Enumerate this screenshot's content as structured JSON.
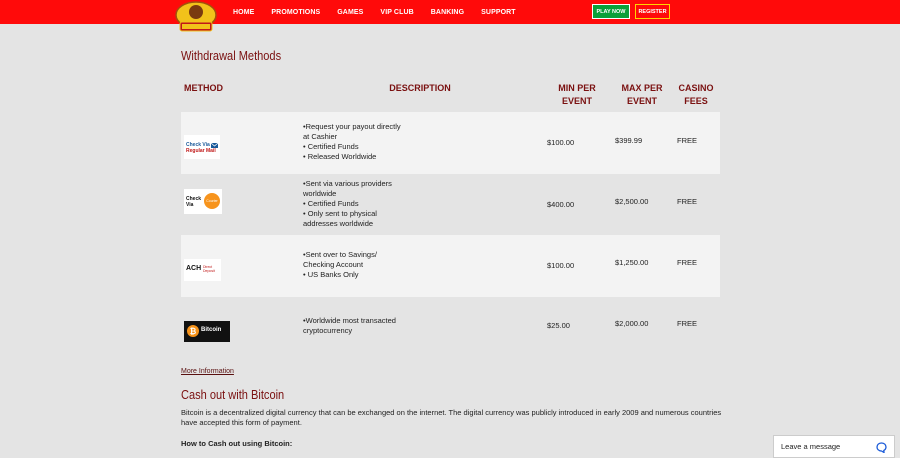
{
  "nav": {
    "items": [
      "HOME",
      "PROMOTIONS",
      "GAMES",
      "VIP CLUB",
      "BANKING",
      "SUPPORT"
    ],
    "play_label": "PLAY NOW",
    "register_label": "REGISTER"
  },
  "page": {
    "title": "Withdrawal Methods",
    "more_info": "More Information",
    "section2_title": "Cash out with Bitcoin",
    "section2_text": "Bitcoin is a decentralized digital currency that can be exchanged on the internet. The digital currency was publicly introduced in early 2009 and numerous countries have accepted this form of payment.",
    "section2_subhead": "How to Cash out using Bitcoin:"
  },
  "table": {
    "headers": {
      "method": "METHOD",
      "description": "DESCRIPTION",
      "min": [
        "MIN PER",
        "EVENT"
      ],
      "max": [
        "MAX PER",
        "EVENT"
      ],
      "fees": [
        "CASINO",
        "FEES"
      ]
    },
    "rows": [
      {
        "method": "Check Via Regular Mail",
        "logo_lines": [
          "Check Via",
          "Regular Mail"
        ],
        "desc": [
          "•Request your payout directly",
          "at Cashier",
          "• Certified Funds",
          "• Released Worldwide"
        ],
        "min": "$100.00",
        "max": "$399.99",
        "fee": "FREE"
      },
      {
        "method": "Check Via Courier",
        "logo_lines": [
          "Check",
          "Via",
          "Courier"
        ],
        "desc": [
          "•Sent via various providers",
          "worldwide",
          "• Certified Funds",
          "• Only sent to physical",
          "addresses worldwide"
        ],
        "min": "$400.00",
        "max": "$2,500.00",
        "fee": "FREE"
      },
      {
        "method": "ACH Direct Deposit",
        "logo_lines": [
          "ACH",
          "Direct",
          "Deposit"
        ],
        "desc": [
          "•Sent over to Savings/",
          "Checking Account",
          "• US Banks Only"
        ],
        "min": "$100.00",
        "max": "$1,250.00",
        "fee": "FREE"
      },
      {
        "method": "Bitcoin",
        "logo_lines": [
          "Bitcoin"
        ],
        "desc": [
          "•Worldwide most transacted",
          "cryptocurrency"
        ],
        "min": "$25.00",
        "max": "$2,000.00",
        "fee": "FREE"
      }
    ]
  },
  "chat": {
    "label": "Leave a message"
  },
  "colors": {
    "header_red": "#ff0a0a",
    "heading_maroon": "#7a1010",
    "play_green": "#0aa03a"
  }
}
